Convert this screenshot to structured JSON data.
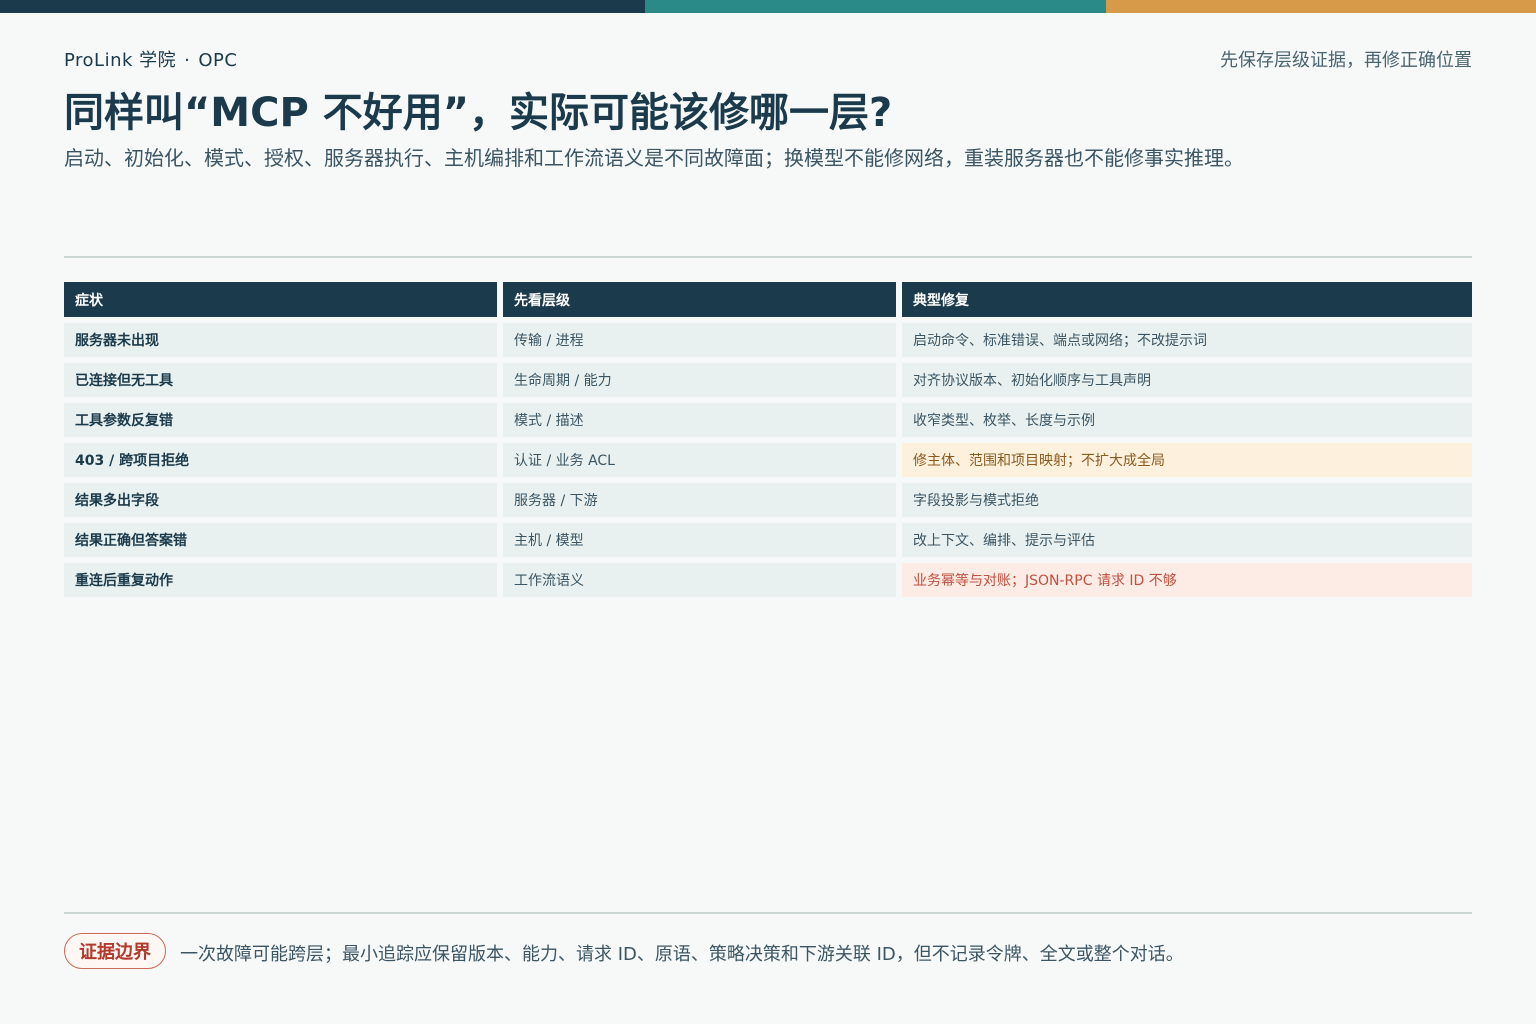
{
  "header": {
    "brand_left": "ProLink 学院",
    "brand_sep": "·",
    "brand_right": "OPC",
    "tagline": "先保存层级证据，再修正确位置"
  },
  "title": "同样叫“MCP 不好用”，实际可能该修哪一层?",
  "subtitle": "启动、初始化、模式、授权、服务器执行、主机编排和工作流语义是不同故障面；换模型不能修网络，重装服务器也不能修事实推理。",
  "table": {
    "headers": [
      "症状",
      "先看层级",
      "典型修复"
    ],
    "rows": [
      {
        "symptom": "服务器未出现",
        "layer": "传输 / 进程",
        "fix": "启动命令、标准错误、端点或网络；不改提示词",
        "highlight": "none"
      },
      {
        "symptom": "已连接但无工具",
        "layer": "生命周期 / 能力",
        "fix": "对齐协议版本、初始化顺序与工具声明",
        "highlight": "none"
      },
      {
        "symptom": "工具参数反复错",
        "layer": "模式 / 描述",
        "fix": "收窄类型、枚举、长度与示例",
        "highlight": "none"
      },
      {
        "symptom": "403 / 跨项目拒绝",
        "layer": "认证 / 业务 ACL",
        "fix": "修主体、范围和项目映射；不扩大成全局",
        "highlight": "warn"
      },
      {
        "symptom": "结果多出字段",
        "layer": "服务器 / 下游",
        "fix": "字段投影与模式拒绝",
        "highlight": "none"
      },
      {
        "symptom": "结果正确但答案错",
        "layer": "主机 / 模型",
        "fix": "改上下文、编排、提示与评估",
        "highlight": "none"
      },
      {
        "symptom": "重连后重复动作",
        "layer": "工作流语义",
        "fix": "业务幂等与对账；JSON-RPC 请求 ID 不够",
        "highlight": "danger"
      }
    ]
  },
  "footer": {
    "badge": "证据边界",
    "note": "一次故障可能跨层；最小追踪应保留版本、能力、请求 ID、原语、策略决策和下游关联 ID，但不记录令牌、全文或整个对话。"
  },
  "colors": {
    "navy": "#1b3a4b",
    "teal": "#2a8a88",
    "amber": "#d69a48",
    "warn_bg": "#fdf0dc",
    "danger_bg": "#fdece6",
    "danger_text": "#c0503f"
  }
}
